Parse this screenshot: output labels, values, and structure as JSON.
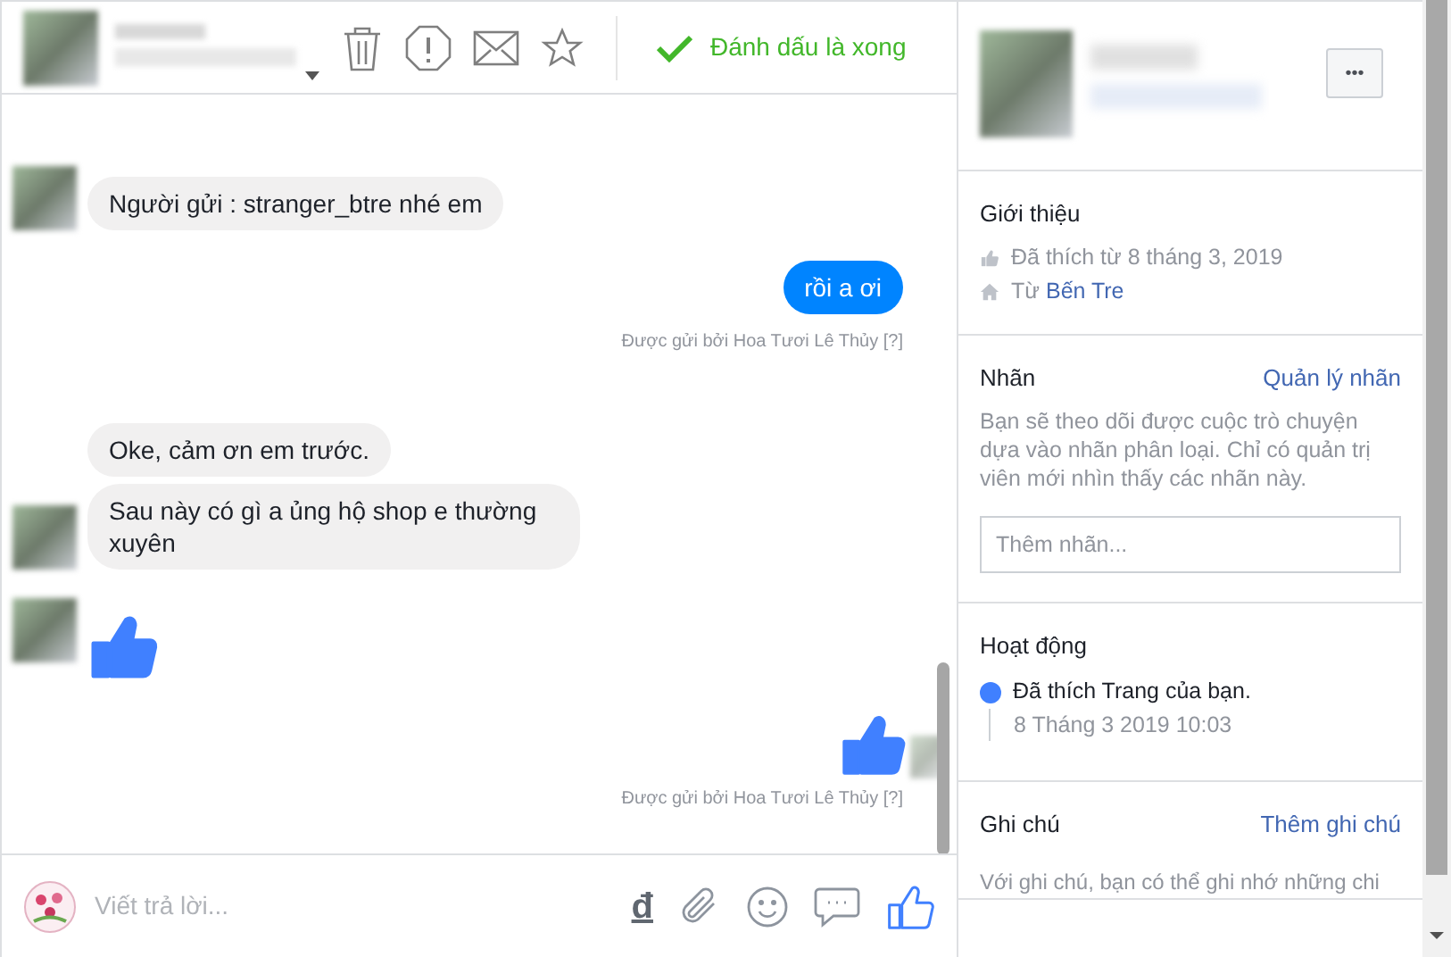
{
  "header": {
    "done_label": "Đánh dấu là xong"
  },
  "messages": [
    {
      "kind": "incoming",
      "text": "Người gửi : stranger_btre nhé em",
      "avatar": true
    },
    {
      "kind": "outgoing",
      "text": "rồi a ơi"
    },
    {
      "kind": "sent_by",
      "text": "Được gửi bởi Hoa Tươi Lê Thủy [?]"
    },
    {
      "kind": "incoming",
      "text": "Oke, cảm ơn em trước.",
      "avatar": false
    },
    {
      "kind": "incoming",
      "text": "Sau này có gì a ủng hộ shop e thường xuyên",
      "avatar": true
    },
    {
      "kind": "incoming_like",
      "avatar": true
    },
    {
      "kind": "outgoing_like"
    },
    {
      "kind": "sent_by",
      "text": "Được gửi bởi Hoa Tươi Lê Thủy [?]"
    }
  ],
  "composer": {
    "placeholder": "Viết trả lời...",
    "currency": "đ"
  },
  "profile": {
    "more": "•••"
  },
  "intro": {
    "title": "Giới thiệu",
    "items": [
      {
        "kind": "like",
        "text": "Đã thích từ 8 tháng 3, 2019"
      },
      {
        "kind": "home",
        "text": "Từ ",
        "link": "Bến Tre"
      }
    ]
  },
  "labels": {
    "title": "Nhãn",
    "action": "Quản lý nhãn",
    "description": "Bạn sẽ theo dõi được cuộc trò chuyện dựa vào nhãn phân loại. Chỉ có quản trị viên mới nhìn thấy các nhãn này.",
    "placeholder": "Thêm nhãn..."
  },
  "activity": {
    "title": "Hoạt động",
    "items": [
      {
        "text": "Đã thích Trang của bạn.",
        "time": "8 Tháng 3 2019 10:03"
      }
    ]
  },
  "notes": {
    "title": "Ghi chú",
    "action": "Thêm ghi chú",
    "description": "Với ghi chú, bạn có thể ghi nhớ những chi"
  }
}
